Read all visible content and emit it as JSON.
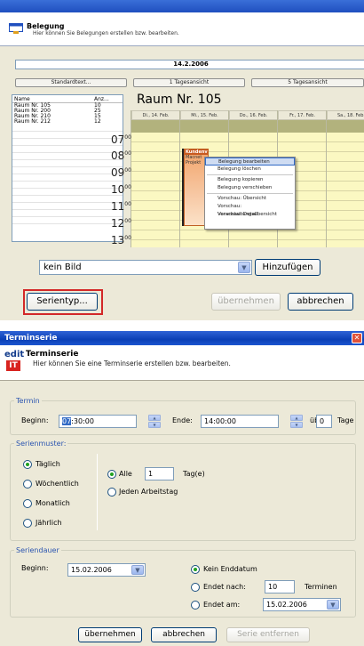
{
  "belegung": {
    "header_title": "Belegung",
    "header_subtitle": "Hier können Sie Belegungen erstellen bzw. bearbeiten.",
    "date": "14.2.2006",
    "buttons": {
      "standardtext": "Standardtext...",
      "one_day": "1 Tagesansicht",
      "five_days": "5 Tagesansicht"
    },
    "list": {
      "columns": [
        "Name",
        "Anz..."
      ],
      "rows": [
        [
          "Raum Nr. 105",
          "10"
        ],
        [
          "Raum Nr. 200",
          "25"
        ],
        [
          "Raum Nr. 210",
          "15"
        ],
        [
          "Raum Nr. 212",
          "12"
        ]
      ]
    },
    "room_title": "Raum Nr. 105",
    "days": [
      "Di., 14. Feb.",
      "Mi., 15. Feb.",
      "Do., 16. Feb.",
      "Fr., 17. Feb.",
      "Sa., 18. Feb."
    ],
    "hours": [
      "07",
      "08",
      "09",
      "10",
      "11",
      "12",
      "13"
    ],
    "hour_suffix": "00",
    "event": {
      "title": "Kundenver...",
      "line1": "Macnet",
      "line2": "Projekt"
    },
    "context_menu": [
      "Belegung bearbeiten",
      "Belegung löschen",
      "Belegung kopieren",
      "Belegung verschieben",
      "Vorschau: Übersicht",
      "Vorschau: Veranstaltungsübersicht",
      "Vorschau: Detail"
    ]
  },
  "mid": {
    "image_combo": "kein Bild",
    "hinzufuegen": "Hinzufügen",
    "serientyp": "Serientyp...",
    "uebernehmen": "übernehmen",
    "abbrechen": "abbrechen"
  },
  "dialog": {
    "title": "Terminserie",
    "close_glyph": "✕",
    "logo_top": "edit",
    "logo_bottom": "IT",
    "header_title": "Terminserie",
    "header_subtitle": "Hier können Sie eine Terminserie erstellen bzw. bearbeiten.",
    "termin": {
      "legend": "Termin",
      "begin_label": "Beginn:",
      "begin_hour": "07",
      "begin_rest": ":30:00",
      "end_label": "Ende:",
      "end_value": "14:00:00",
      "ueber_label": "über",
      "days_value": "0",
      "days_label": "Tage"
    },
    "muster": {
      "legend": "Serienmuster:",
      "options": [
        "Täglich",
        "Wöchentlich",
        "Monatlich",
        "Jährlich"
      ],
      "selected": "Täglich",
      "alle_label": "Alle",
      "alle_value": "1",
      "tage_label": "Tag(e)",
      "arbeitstag_label": "Jeden Arbeitstag"
    },
    "dauer": {
      "legend": "Seriendauer",
      "begin_label": "Beginn:",
      "begin_value": "15.02.2006",
      "kein_enddatum": "Kein Enddatum",
      "endet_nach": "Endet nach:",
      "endet_nach_value": "10",
      "termine_label": "Terminen",
      "endet_am": "Endet am:",
      "endet_am_value": "15.02.2006"
    },
    "buttons": {
      "uebernehmen": "übernehmen",
      "abbrechen": "abbrechen",
      "serie_entfernen": "Serie entfernen"
    }
  }
}
